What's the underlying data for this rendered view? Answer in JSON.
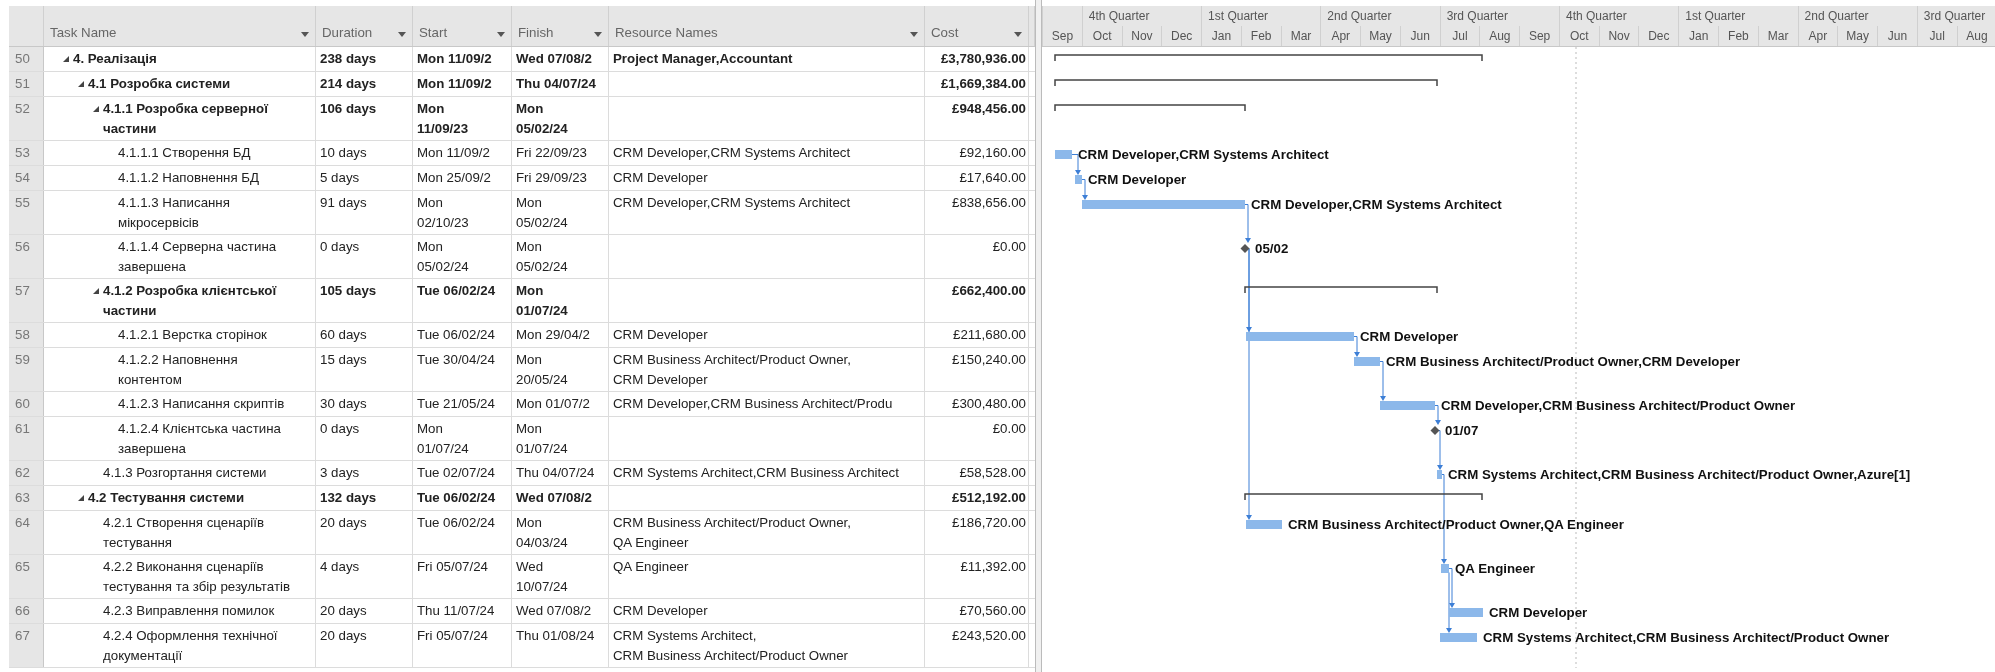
{
  "table": {
    "columns": [
      {
        "label": "Task Name"
      },
      {
        "label": "Duration"
      },
      {
        "label": "Start"
      },
      {
        "label": "Finish"
      },
      {
        "label": "Resource Names"
      },
      {
        "label": "Cost"
      }
    ],
    "tasks": [
      {
        "id": "50",
        "name": "4. Реалізація",
        "kind": "summary",
        "expanded": true,
        "duration": "238 days",
        "start": "Mon 11/09/2",
        "finish": "Wed 07/08/2",
        "resources": "Project Manager,Accountant",
        "cost": "£3,780,936.00",
        "children": [
          {
            "id": "51",
            "name": "4.1 Розробка системи",
            "kind": "summary",
            "expanded": true,
            "duration": "214 days",
            "start": "Mon 11/09/2",
            "finish": "Thu 04/07/24",
            "cost": "£1,669,384.00",
            "children": [
              {
                "id": "52",
                "name": "4.1.1 Розробка серверної\nчастини",
                "kind": "summary",
                "expanded": true,
                "duration": "106 days",
                "start": "Mon\n11/09/23",
                "finish": "Mon\n05/02/24",
                "cost": "£948,456.00",
                "children": [
                  {
                    "id": "53",
                    "name": "4.1.1.1 Створення БД",
                    "kind": "task",
                    "duration": "10 days",
                    "start": "Mon 11/09/2",
                    "finish": "Fri 22/09/23",
                    "resources": "CRM Developer,CRM Systems Architect",
                    "cost": "£92,160.00",
                    "bar_label": "CRM Developer,CRM Systems Architect"
                  },
                  {
                    "id": "54",
                    "name": "4.1.1.2 Наповнення БД",
                    "kind": "task",
                    "duration": "5 days",
                    "start": "Mon 25/09/2",
                    "finish": "Fri 29/09/23",
                    "resources": "CRM Developer",
                    "cost": "£17,640.00",
                    "bar_label": "CRM Developer"
                  },
                  {
                    "id": "55",
                    "name": "4.1.1.3 Написання\nмікросервісів",
                    "kind": "task",
                    "duration": "91 days",
                    "start": "Mon\n02/10/23",
                    "finish": "Mon\n05/02/24",
                    "resources": "CRM Developer,CRM Systems Architect",
                    "cost": "£838,656.00",
                    "bar_label": "CRM Developer,CRM Systems Architect"
                  },
                  {
                    "id": "56",
                    "name": "4.1.1.4 Серверна частина\nзавершена",
                    "kind": "milestone",
                    "duration": "0 days",
                    "start": "Mon\n05/02/24",
                    "finish": "Mon\n05/02/24",
                    "cost": "£0.00",
                    "bar_label": "05/02"
                  }
                ]
              },
              {
                "id": "57",
                "name": "4.1.2 Розробка клієнтської\nчастини",
                "kind": "summary",
                "expanded": true,
                "duration": "105 days",
                "start": "Tue 06/02/24",
                "finish": "Mon\n01/07/24",
                "cost": "£662,400.00",
                "children": [
                  {
                    "id": "58",
                    "name": "4.1.2.1 Верстка сторінок",
                    "kind": "task",
                    "duration": "60 days",
                    "start": "Tue 06/02/24",
                    "finish": "Mon 29/04/2",
                    "resources": "CRM Developer",
                    "cost": "£211,680.00",
                    "bar_label": "CRM Developer"
                  },
                  {
                    "id": "59",
                    "name": "4.1.2.2 Наповнення\nконтентом",
                    "kind": "task",
                    "duration": "15 days",
                    "start": "Tue 30/04/24",
                    "finish": "Mon\n20/05/24",
                    "resources": "CRM Business Architect/Product Owner,\nCRM Developer",
                    "cost": "£150,240.00",
                    "bar_label": "CRM Business Architect/Product Owner,CRM Developer"
                  },
                  {
                    "id": "60",
                    "name": "4.1.2.3 Написання скриптів",
                    "kind": "task",
                    "duration": "30 days",
                    "start": "Tue 21/05/24",
                    "finish": "Mon 01/07/2",
                    "resources": "CRM Developer,CRM Business Architect/Produ",
                    "cost": "£300,480.00",
                    "bar_label": "CRM Developer,CRM Business Architect/Product Owner"
                  },
                  {
                    "id": "61",
                    "name": "4.1.2.4 Клієнтська частина\nзавершена",
                    "kind": "milestone",
                    "duration": "0 days",
                    "start": "Mon\n01/07/24",
                    "finish": "Mon\n01/07/24",
                    "cost": "£0.00",
                    "bar_label": "01/07"
                  }
                ]
              },
              {
                "id": "62",
                "name": "4.1.3 Розгортання системи",
                "kind": "task",
                "duration": "3 days",
                "start": "Tue 02/07/24",
                "finish": "Thu 04/07/24",
                "resources": "CRM Systems Architect,CRM Business Architect",
                "cost": "£58,528.00",
                "bar_label": "CRM Systems Architect,CRM Business Architect/Product Owner,Azure[1]"
              }
            ]
          },
          {
            "id": "63",
            "name": "4.2 Тестування системи",
            "kind": "summary",
            "expanded": true,
            "duration": "132 days",
            "start": "Tue 06/02/24",
            "finish": "Wed 07/08/2",
            "cost": "£512,192.00",
            "children": [
              {
                "id": "64",
                "name": "4.2.1 Створення сценаріїв\nтестування",
                "kind": "task",
                "duration": "20 days",
                "start": "Tue 06/02/24",
                "finish": "Mon\n04/03/24",
                "resources": "CRM Business Architect/Product Owner,\nQA Engineer",
                "cost": "£186,720.00",
                "bar_label": "CRM Business Architect/Product Owner,QA Engineer"
              },
              {
                "id": "65",
                "name": "4.2.2 Виконання сценаріїв\nтестування та збір результатів",
                "kind": "task",
                "duration": "4 days",
                "start": "Fri 05/07/24",
                "finish": "Wed\n10/07/24",
                "resources": "QA Engineer",
                "cost": "£11,392.00",
                "bar_label": "QA Engineer"
              },
              {
                "id": "66",
                "name": "4.2.3 Виправлення помилок",
                "kind": "task",
                "duration": "20 days",
                "start": "Thu 11/07/24",
                "finish": "Wed 07/08/2",
                "resources": "CRM Developer",
                "cost": "£70,560.00",
                "bar_label": "CRM Developer"
              },
              {
                "id": "67",
                "name": "4.2.4 Оформлення технічної\nдокументації",
                "kind": "task",
                "duration": "20 days",
                "start": "Fri 05/07/24",
                "finish": "Thu 01/08/24",
                "resources": "CRM Systems Architect,\nCRM Business Architect/Product Owner",
                "cost": "£243,520.00",
                "bar_label": "CRM Systems Architect,CRM Business Architect/Product Owner"
              }
            ]
          }
        ]
      }
    ]
  },
  "timeline": {
    "quarters": [
      "4th Quarter",
      "1st Quarter",
      "2nd Quarter",
      "3rd Quarter",
      "4th Quarter",
      "1st Quarter",
      "2nd Quarter",
      "3rd Quarter"
    ],
    "months": [
      "Sep",
      "Oct",
      "Nov",
      "Dec",
      "Jan",
      "Feb",
      "Mar",
      "Apr",
      "May",
      "Jun",
      "Jul",
      "Aug",
      "Sep",
      "Oct",
      "Nov",
      "Dec",
      "Jan",
      "Feb",
      "Mar",
      "Apr",
      "May",
      "Jun",
      "Jul",
      "Aug"
    ]
  }
}
